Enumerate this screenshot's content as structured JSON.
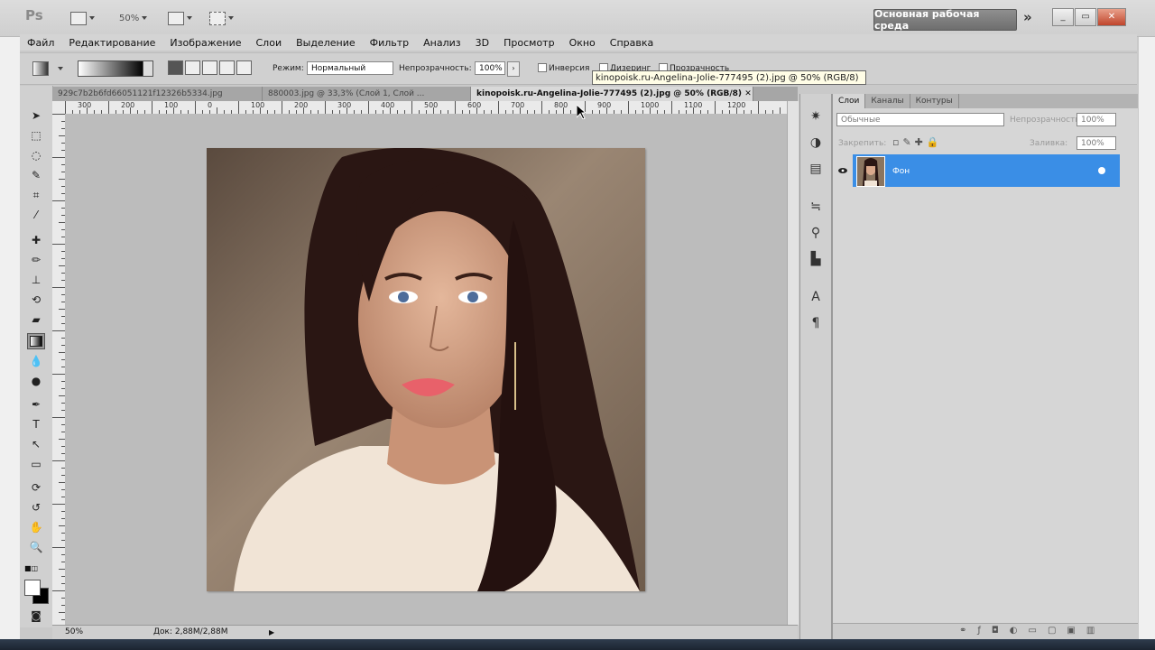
{
  "app": {
    "logo": "Ps",
    "zoom_button": "50%",
    "workspace_button": "Основная рабочая среда",
    "more_button": "»"
  },
  "window_controls": {
    "minimize": "_",
    "restore": "▭",
    "close": "✕"
  },
  "menu": [
    "Файл",
    "Редактирование",
    "Изображение",
    "Слои",
    "Выделение",
    "Фильтр",
    "Анализ",
    "3D",
    "Просмотр",
    "Окно",
    "Справка"
  ],
  "options": {
    "mode_label": "Режим:",
    "mode_value": "Нормальный",
    "opacity_label": "Непрозрачность:",
    "opacity_value": "100%",
    "inverse_label": "Инверсия",
    "dither_label": "Дизеринг",
    "transparency_label": "Прозрачность"
  },
  "tooltip": "kinopoisk.ru-Angelina-Jolie-777495 (2).jpg @ 50% (RGB/8)",
  "tabs": [
    {
      "label": "929c7b2b6fd66051121f12326b5334.jpg"
    },
    {
      "label": "880003.jpg @ 33,3% (Слой 1, Слой ..."
    },
    {
      "label": "kinopoisk.ru-Angelina-Jolie-777495 (2).jpg @ 50% (RGB/8)"
    }
  ],
  "ruler_labels": [
    "300",
    "200",
    "100",
    "0",
    "100",
    "200",
    "300",
    "400",
    "500",
    "600",
    "700",
    "800",
    "900",
    "1000",
    "1100",
    "1200"
  ],
  "status": {
    "zoom": "50%",
    "doc": "Док: 2,88M/2,88M"
  },
  "layers_panel": {
    "tabs": [
      "Слои",
      "Каналы",
      "Контуры"
    ],
    "blend_mode": "Обычные",
    "opacity_label": "Непрозрачность:",
    "opacity_value": "100%",
    "fill_label": "Заливка:",
    "fill_value": "100%",
    "lock_label": "Закрепить:",
    "layer_name": "Фон"
  }
}
